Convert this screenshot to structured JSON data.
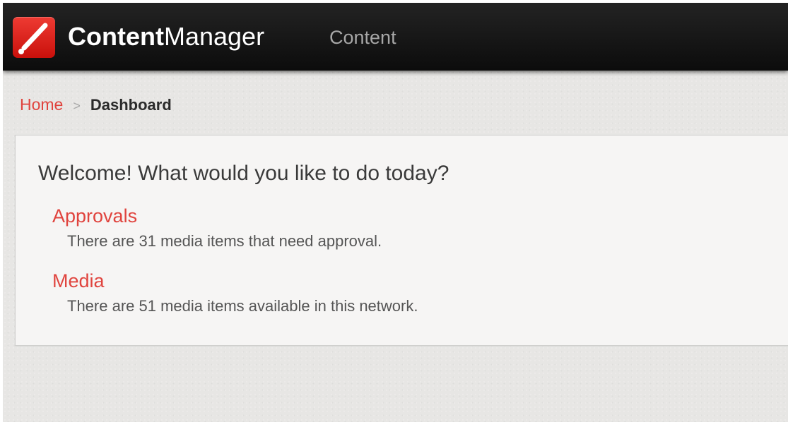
{
  "header": {
    "brand_bold": "Content",
    "brand_regular": "Manager",
    "logo_icon": "pencil-logo-icon",
    "nav": [
      {
        "label": "Content"
      }
    ]
  },
  "breadcrumb": {
    "home": "Home",
    "separator": ">",
    "current": "Dashboard"
  },
  "main": {
    "welcome": "Welcome! What would you like to do today?",
    "items": [
      {
        "title": "Approvals",
        "description": "There are 31 media items that need approval."
      },
      {
        "title": "Media",
        "description": "There are 51 media items available in this network."
      }
    ]
  },
  "colors": {
    "accent": "#e0443e",
    "header_bg": "#111111",
    "page_bg": "#e7e6e4",
    "panel_bg": "#f6f5f4"
  }
}
